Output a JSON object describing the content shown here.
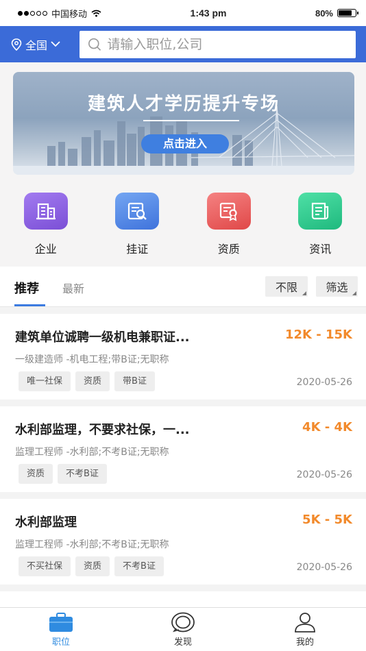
{
  "status": {
    "carrier": "中国移动",
    "time": "1:43 pm",
    "battery": "80%",
    "battery_level": 0.8
  },
  "header": {
    "city": "全国",
    "search_placeholder": "请输入职位,公司"
  },
  "banner": {
    "title": "建筑人才学历提升专场",
    "button": "点击进入"
  },
  "categories": [
    {
      "label": "企业",
      "icon": "building-icon",
      "color": "#8b5fe0"
    },
    {
      "label": "挂证",
      "icon": "certificate-search-icon",
      "color": "#4f86e8"
    },
    {
      "label": "资质",
      "icon": "qualification-icon",
      "color": "#ec5a5a"
    },
    {
      "label": "资讯",
      "icon": "news-icon",
      "color": "#2fc98c"
    }
  ],
  "tabs": {
    "recommend": "推荐",
    "latest": "最新",
    "filter_any": "不限",
    "filter": "筛选"
  },
  "jobs": [
    {
      "title": "建筑单位诚聘一级机电兼职证...",
      "salary": "12K - 15K",
      "desc": "一级建造师 -机电工程;带B证;无职称",
      "tags": [
        "唯一社保",
        "资质",
        "带B证"
      ],
      "date": "2020-05-26"
    },
    {
      "title": "水利部监理，不要求社保，一...",
      "salary": "4K - 4K",
      "desc": "监理工程师 -水利部;不考B证;无职称",
      "tags": [
        "资质",
        "不考B证"
      ],
      "date": "2020-05-26"
    },
    {
      "title": "水利部监理",
      "salary": "5K - 5K",
      "desc": "监理工程师 -水利部;不考B证;无职称",
      "tags": [
        "不买社保",
        "资质",
        "不考B证"
      ],
      "date": "2020-05-26"
    }
  ],
  "tabbar": {
    "jobs": "职位",
    "discover": "发现",
    "mine": "我的",
    "active_color": "#2f8be0"
  }
}
